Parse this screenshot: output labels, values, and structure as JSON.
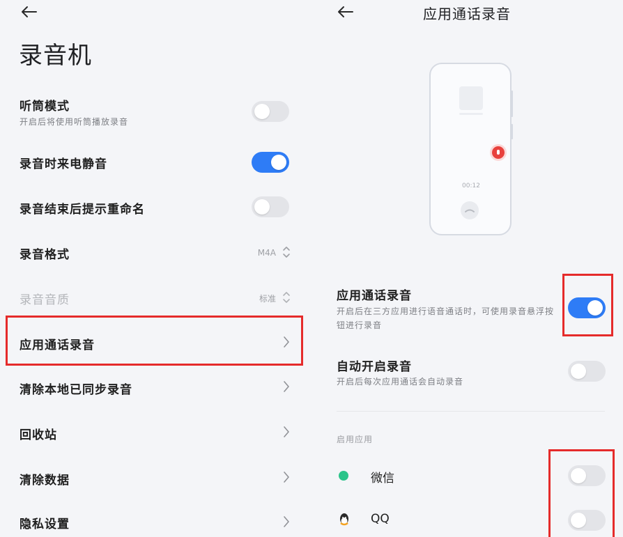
{
  "left_panel": {
    "title": "录音机",
    "settings": [
      {
        "label": "听筒模式",
        "sub": "开启后将使用听筒播放录音",
        "toggle": false
      },
      {
        "label": "录音时来电静音",
        "toggle": true
      },
      {
        "label": "录音结束后提示重命名",
        "toggle": false
      },
      {
        "label": "录音格式",
        "value": "M4A"
      },
      {
        "label": "录音音质",
        "value": "标准"
      },
      {
        "label": "应用通话录音"
      },
      {
        "label": "清除本地已同步录音"
      },
      {
        "label": "回收站"
      },
      {
        "label": "清除数据"
      },
      {
        "label": "隐私设置"
      }
    ]
  },
  "right_panel": {
    "title": "应用通话录音",
    "phone_timer": "00:12",
    "app_call_recording": {
      "label": "应用通话录音",
      "sub": "开启后在三方应用进行语音通话时，可使用录音悬浮按钮进行录音",
      "toggle": true
    },
    "auto_start": {
      "label": "自动开启录音",
      "sub": "开启后每次应用通话会自动录音",
      "toggle": false
    },
    "section_label": "启用应用",
    "apps": [
      {
        "name": "微信",
        "icon": "wechat-icon",
        "toggle": false
      },
      {
        "name": "QQ",
        "icon": "qq-icon",
        "toggle": false
      }
    ]
  },
  "colors": {
    "accent": "#2e7cf6",
    "highlight": "#e52b2b",
    "toggle_off": "#e3e4e8",
    "background": "#f4f5f8"
  }
}
